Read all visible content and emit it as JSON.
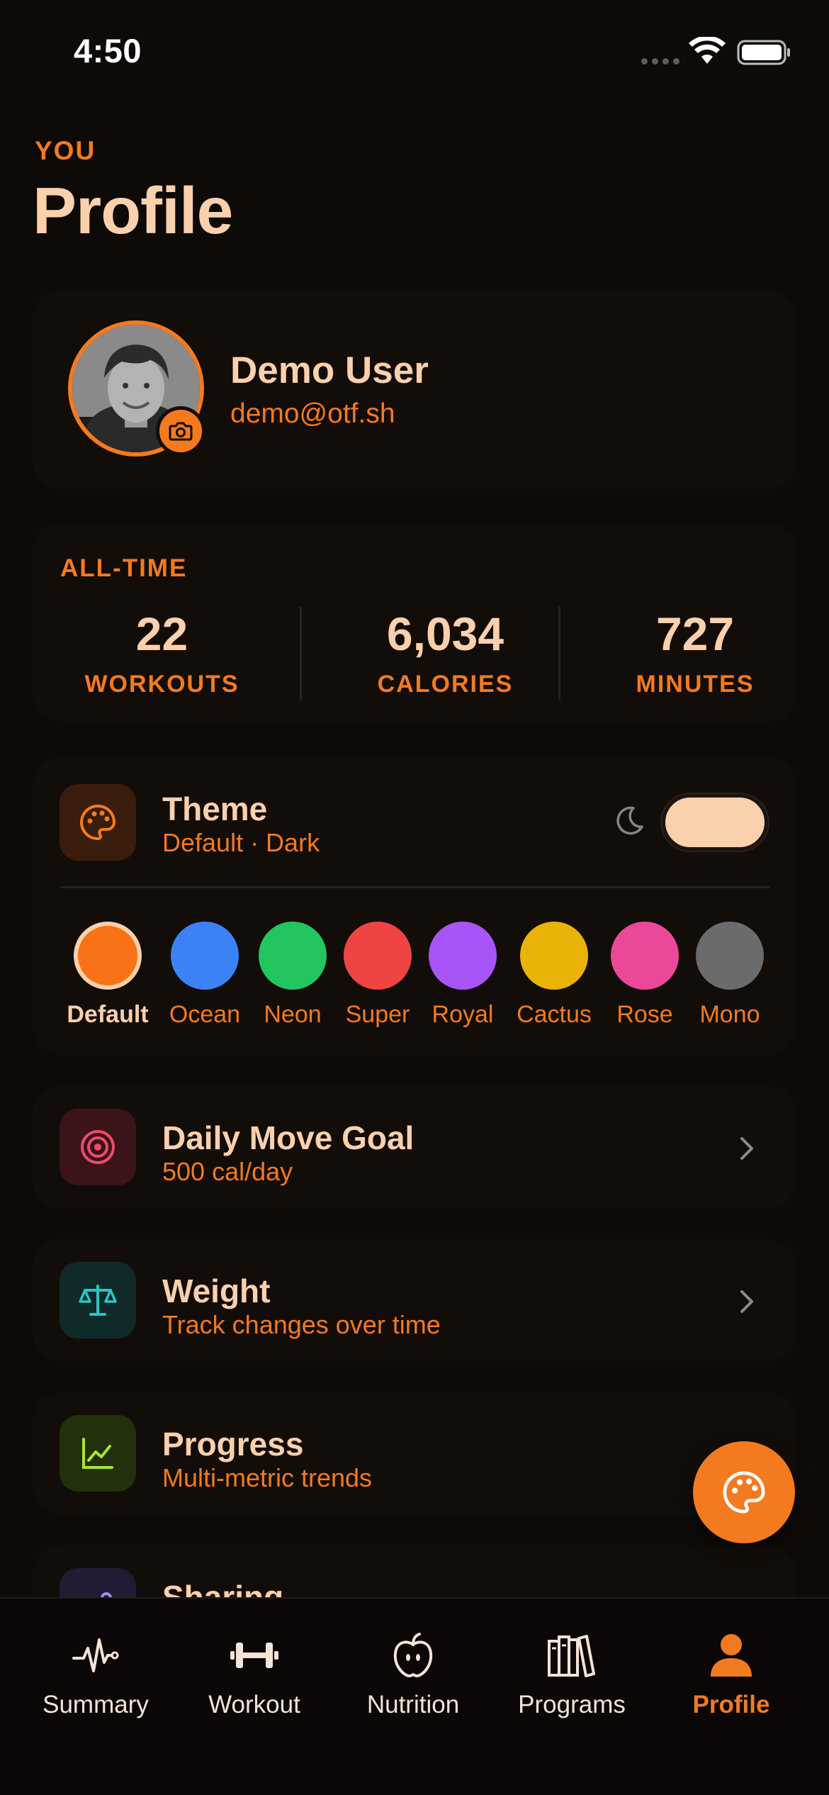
{
  "status": {
    "time": "4:50"
  },
  "header": {
    "eyebrow": "YOU",
    "title": "Profile"
  },
  "profile": {
    "name": "Demo User",
    "email": "demo@otf.sh"
  },
  "stats": {
    "label": "ALL-TIME",
    "items": [
      {
        "value": "22",
        "label": "WORKOUTS"
      },
      {
        "value": "6,034",
        "label": "CALORIES"
      },
      {
        "value": "727",
        "label": "MINUTES"
      }
    ]
  },
  "theme": {
    "title": "Theme",
    "subtitle": "Default · Dark",
    "dark_mode_on": true,
    "swatches": [
      {
        "label": "Default",
        "color": "#f97316",
        "selected": true
      },
      {
        "label": "Ocean",
        "color": "#3b82f6"
      },
      {
        "label": "Neon",
        "color": "#22c55e"
      },
      {
        "label": "Super",
        "color": "#ef4444"
      },
      {
        "label": "Royal",
        "color": "#a855f7"
      },
      {
        "label": "Cactus",
        "color": "#eab308"
      },
      {
        "label": "Rose",
        "color": "#ec4899"
      },
      {
        "label": "Mono",
        "color": "#6b6b6b"
      }
    ]
  },
  "rows": [
    {
      "title": "Daily Move Goal",
      "subtitle": "500 cal/day",
      "icon": "target-icon"
    },
    {
      "title": "Weight",
      "subtitle": "Track changes over time",
      "icon": "scale-icon"
    },
    {
      "title": "Progress",
      "subtitle": "Multi-metric trends",
      "icon": "chart-icon"
    },
    {
      "title": "Sharing",
      "subtitle": "",
      "icon": "share-icon"
    }
  ],
  "fab": {
    "icon": "palette-icon"
  },
  "tabs": [
    {
      "label": "Summary",
      "icon": "heartbeat-icon"
    },
    {
      "label": "Workout",
      "icon": "dumbbell-icon"
    },
    {
      "label": "Nutrition",
      "icon": "apple-icon"
    },
    {
      "label": "Programs",
      "icon": "books-icon"
    },
    {
      "label": "Profile",
      "icon": "person-icon",
      "active": true
    }
  ],
  "colors": {
    "accent": "#f47a20",
    "text": "#fbd0ad",
    "background": "#0d0a08",
    "card": "#130d0a"
  }
}
